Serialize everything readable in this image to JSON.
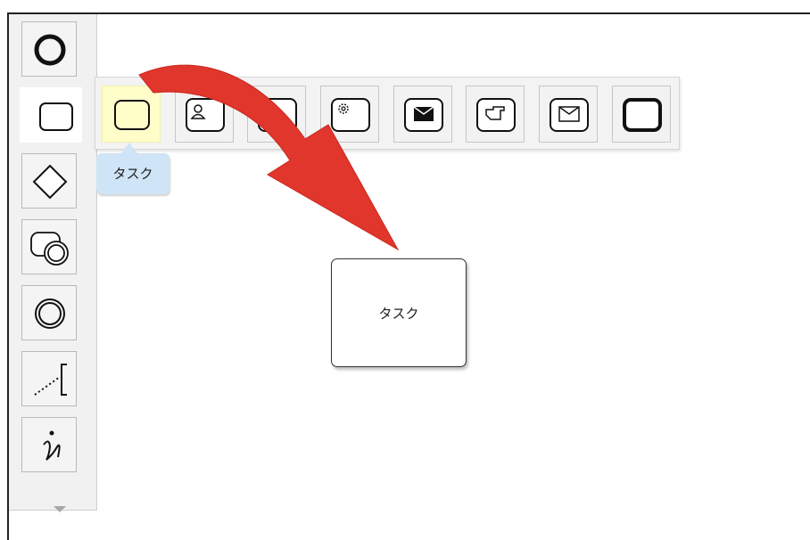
{
  "tooltip": {
    "label": "タスク"
  },
  "canvas": {
    "task_label": "タスク"
  },
  "palette": {
    "items": [
      {
        "name": "start-event",
        "icon": "circle-thick-icon"
      },
      {
        "name": "task",
        "icon": "rounded-rect-icon",
        "active": true
      },
      {
        "name": "gateway",
        "icon": "diamond-icon"
      },
      {
        "name": "subprocess",
        "icon": "overlapping-circles-icon"
      },
      {
        "name": "intermediate-event",
        "icon": "double-circle-icon"
      },
      {
        "name": "annotation",
        "icon": "dotted-bracket-icon"
      },
      {
        "name": "data-object",
        "icon": "info-icon"
      }
    ],
    "more_icon": "chevron-down-icon"
  },
  "popup": {
    "items": [
      {
        "name": "task",
        "icon": "rounded-rect-icon",
        "selected": true
      },
      {
        "name": "user-task",
        "icon": "user-icon"
      },
      {
        "name": "manual-task",
        "icon": "script-icon"
      },
      {
        "name": "service-task",
        "icon": "gear-icon"
      },
      {
        "name": "send-task",
        "icon": "envelope-filled-icon"
      },
      {
        "name": "hand-task",
        "icon": "hand-icon"
      },
      {
        "name": "receive-task",
        "icon": "envelope-outline-icon"
      },
      {
        "name": "call-activity",
        "icon": "thick-rounded-rect-icon"
      }
    ]
  },
  "colors": {
    "arrow": "#e0362c",
    "tooltip": "#cfe4f6",
    "selected": "#fffdc8"
  }
}
